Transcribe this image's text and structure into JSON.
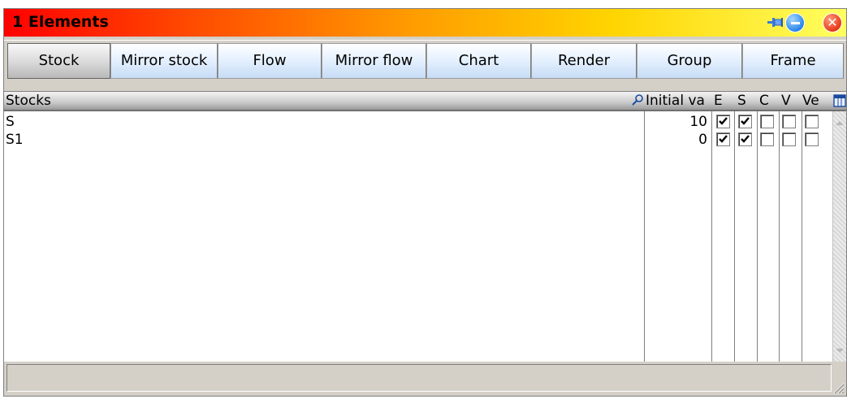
{
  "window": {
    "title": "1  Elements"
  },
  "tabs": [
    "Stock",
    "Mirror stock",
    "Flow",
    "Mirror flow",
    "Chart",
    "Render",
    "Group",
    "Frame"
  ],
  "active_tab": "Stock",
  "table": {
    "headers": {
      "name": "Stocks",
      "initial": "Initial va",
      "e": "E",
      "s": "S",
      "c": "C",
      "v": "V",
      "ve": "Ve"
    },
    "rows": [
      {
        "name": "S",
        "initial": "10",
        "e": true,
        "s": true,
        "c": false,
        "v": false,
        "ve": false
      },
      {
        "name": "S1",
        "initial": "0",
        "e": true,
        "s": true,
        "c": false,
        "v": false,
        "ve": false
      }
    ]
  },
  "icons": {
    "pin": "pin-icon",
    "minimize": "minimize-icon",
    "close": "close-icon",
    "search": "search-icon",
    "columns": "columns-icon"
  }
}
